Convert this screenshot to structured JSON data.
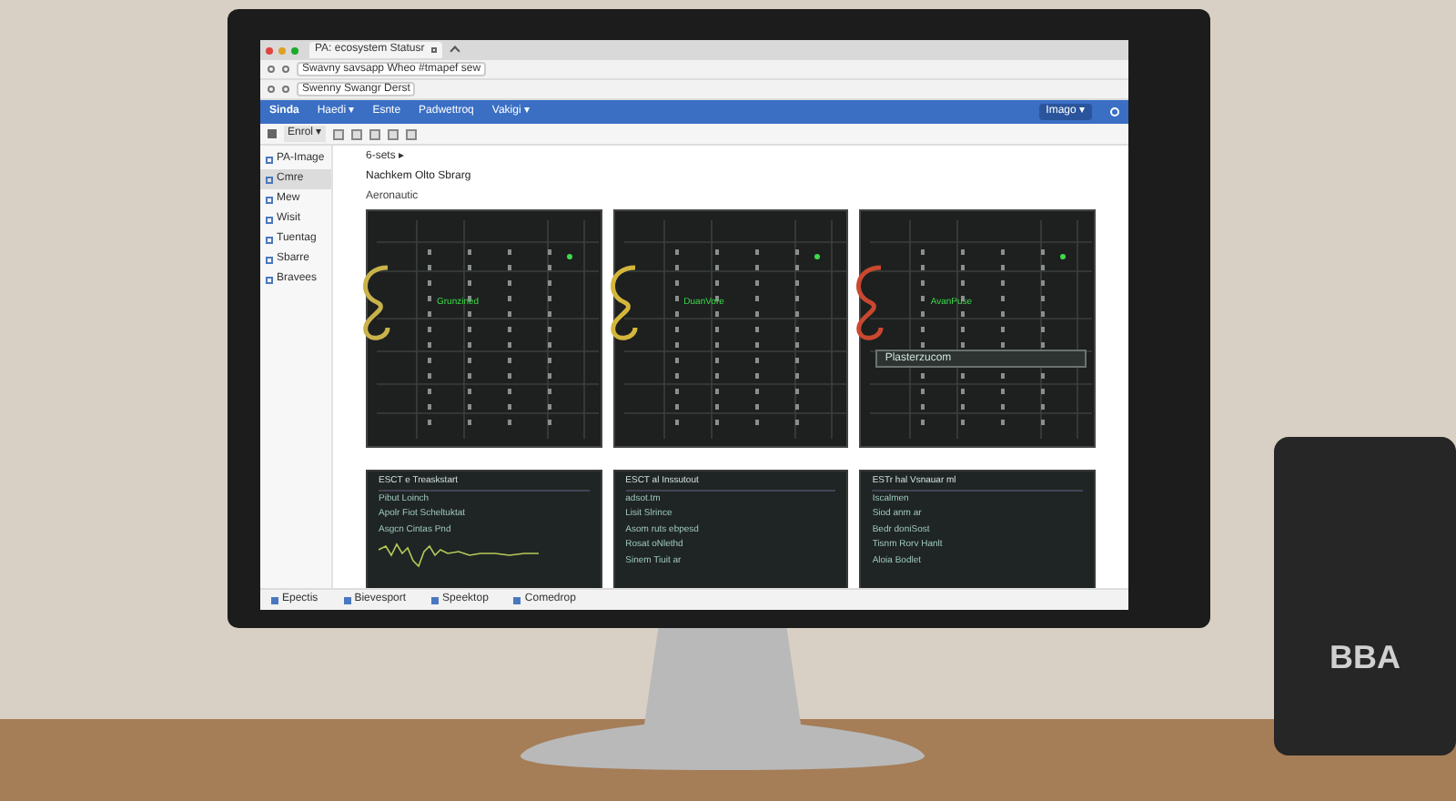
{
  "browser": {
    "tab": {
      "title": "PA: ecosystem Statusr"
    },
    "address_lines": [
      "Swavny savsapp Wheo #tmapef sew",
      "Swenny Swangr Derst"
    ],
    "nav": {
      "brand": "Sinda",
      "items": [
        "Haedi ▾",
        "Esnte",
        "Padwettroq",
        "Vakigi ▾"
      ],
      "account": "Imago ▾"
    },
    "toolbar": {
      "menu": "Enrol ▾"
    },
    "sidebar": {
      "items": [
        {
          "label": "PA-Image",
          "selected": false
        },
        {
          "label": "Cmre",
          "selected": true
        },
        {
          "label": "Mew",
          "selected": false
        },
        {
          "label": "Wisit",
          "selected": false
        },
        {
          "label": "Tuentag",
          "selected": false
        },
        {
          "label": "Sbarre",
          "selected": false
        },
        {
          "label": "Bravees",
          "selected": false
        }
      ]
    },
    "breadcrumb": {
      "path": "6-sets ▸",
      "link": "Nachkem Olto Sbrarg",
      "heading": "Aeronautic"
    },
    "racks": [
      {
        "label": "Grunzined",
        "color": "#c9b24a"
      },
      {
        "label": "DuanVore",
        "color": "#d4b63c"
      },
      {
        "label": "AvanPuse",
        "color": "#c9482f",
        "popup": "Plasterzucom"
      }
    ],
    "panels": [
      {
        "title": "ESCT e Treaskstart",
        "lines": [
          "Pibut Loinch",
          "Apolr Fiot Scheltuktat",
          "Asgcn Cintas Pnd"
        ],
        "kind": "waveform"
      },
      {
        "title": "ESCT al Inssutout",
        "lines": [
          "adsot.tm",
          "Lisit Slrince",
          "Asom ruts ebpesd",
          "Rosat oNlethd",
          "Sinem Tiuit ar"
        ],
        "kind": "log"
      },
      {
        "title": "ESTr hal Vsnauar ml",
        "lines": [
          "Iscalmen",
          "Siod anm ar",
          "Bedr doniSost",
          "Tisnm Rorv Hanlt",
          "Aloia Bodlet"
        ],
        "kind": "log"
      }
    ],
    "status_bar": [
      "Epectis",
      "Bievesport",
      "Speektop",
      "Comedrop"
    ]
  },
  "speaker": {
    "label": "BBA"
  }
}
